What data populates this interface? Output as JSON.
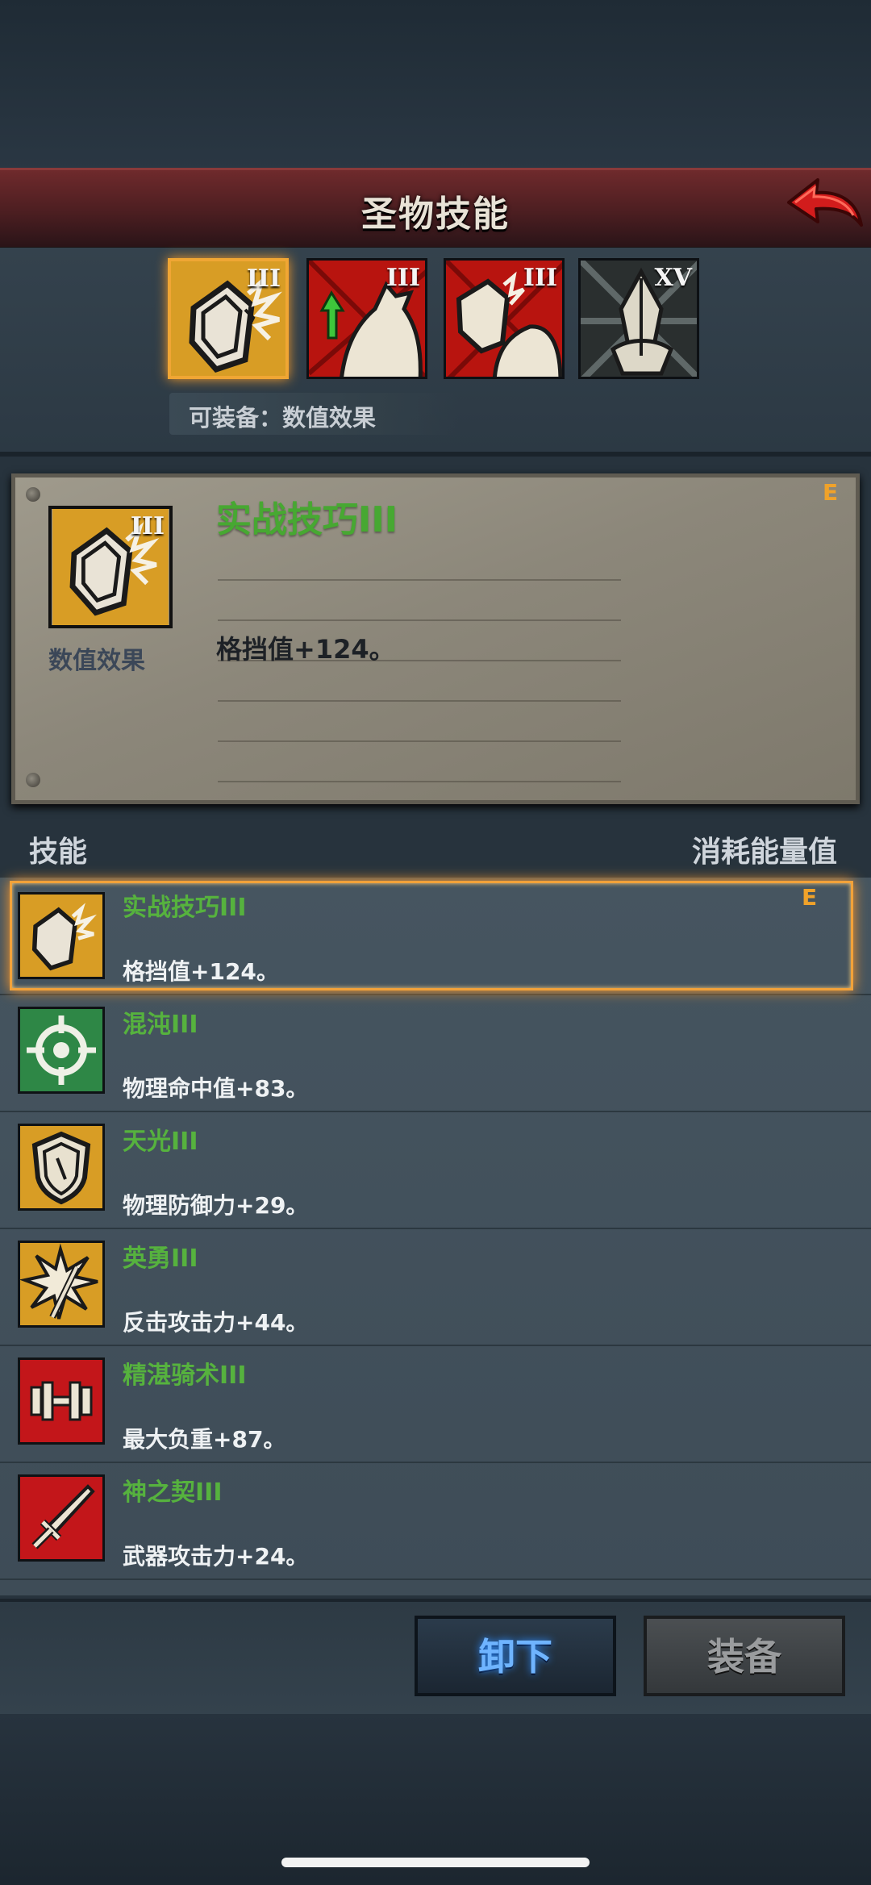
{
  "header": {
    "title": "圣物技能",
    "back_icon": "back-arrow-icon"
  },
  "slots": [
    {
      "name": "combat-skill",
      "level": "III",
      "color": "#e1a52a",
      "active": true
    },
    {
      "name": "horse-boost",
      "level": "III",
      "color": "#c51a14",
      "active": false
    },
    {
      "name": "horse-shield",
      "level": "III",
      "color": "#c51a14",
      "active": false
    },
    {
      "name": "divine-sword",
      "level": "XV",
      "color": "#d9d6c8",
      "active": false
    }
  ],
  "equip_hint": "可装备：数值效果",
  "detail": {
    "name": "实战技巧III",
    "level": "III",
    "type_label": "数值效果",
    "description": "格挡值+124。",
    "grade": "E"
  },
  "list_header": {
    "left": "技能",
    "right": "消耗能量值"
  },
  "skills": [
    {
      "name": "实战技巧III",
      "desc": "格挡值+124。",
      "icon": "shield-shatter-icon",
      "bg": "#d9a02a",
      "grade": "E",
      "selected": true
    },
    {
      "name": "混沌III",
      "desc": "物理命中值+83。",
      "icon": "crosshair-icon",
      "bg": "#2f8a46",
      "grade": "",
      "selected": false
    },
    {
      "name": "天光III",
      "desc": "物理防御力+29。",
      "icon": "shield-icon",
      "bg": "#d9a02a",
      "grade": "",
      "selected": false
    },
    {
      "name": "英勇III",
      "desc": "反击攻击力+44。",
      "icon": "burst-strike-icon",
      "bg": "#d9a02a",
      "grade": "",
      "selected": false
    },
    {
      "name": "精湛骑术III",
      "desc": "最大负重+87。",
      "icon": "dumbbell-icon",
      "bg": "#c8171a",
      "grade": "",
      "selected": false
    },
    {
      "name": "神之契III",
      "desc": "武器攻击力+24。",
      "icon": "sword-icon",
      "bg": "#c8171a",
      "grade": "",
      "selected": false
    }
  ],
  "buttons": {
    "unequip": "卸下",
    "equip": "装备"
  }
}
